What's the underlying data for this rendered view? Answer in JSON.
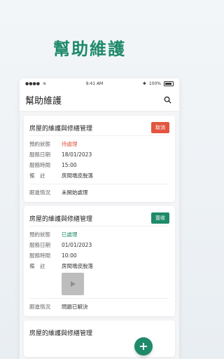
{
  "hero": {
    "title": "幫助維護"
  },
  "status_bar": {
    "time": "9:41 AM",
    "battery": "100%"
  },
  "header": {
    "title": "幫助維護"
  },
  "cards": [
    {
      "title": "房屋的維護與修繕管理",
      "badge": "取消",
      "rows": [
        {
          "label": "預約狀態",
          "value": "待處理"
        },
        {
          "label": "服務日期",
          "value": "18/01/2023"
        },
        {
          "label": "服務時間",
          "value": "15:00"
        },
        {
          "label": "備　註",
          "value": "房間墻皮脫落"
        }
      ],
      "progress": {
        "label": "跟進情況",
        "value": "未開始處理"
      }
    },
    {
      "title": "房屋的維護與修繕管理",
      "badge": "簽收",
      "rows": [
        {
          "label": "預約狀態",
          "value": "已處理"
        },
        {
          "label": "服務日期",
          "value": "01/01/2023"
        },
        {
          "label": "服務時間",
          "value": "10:00"
        },
        {
          "label": "備　註",
          "value": "房間墻皮脫落"
        }
      ],
      "progress": {
        "label": "跟進情況",
        "value": "問題已解決"
      }
    },
    {
      "title": "房屋的維護與修繕管理"
    }
  ],
  "colors": {
    "accent": "#1f8a6a",
    "danger": "#e2553f"
  },
  "icons": {
    "search": "search-icon",
    "add": "plus-icon",
    "play": "play-icon"
  }
}
